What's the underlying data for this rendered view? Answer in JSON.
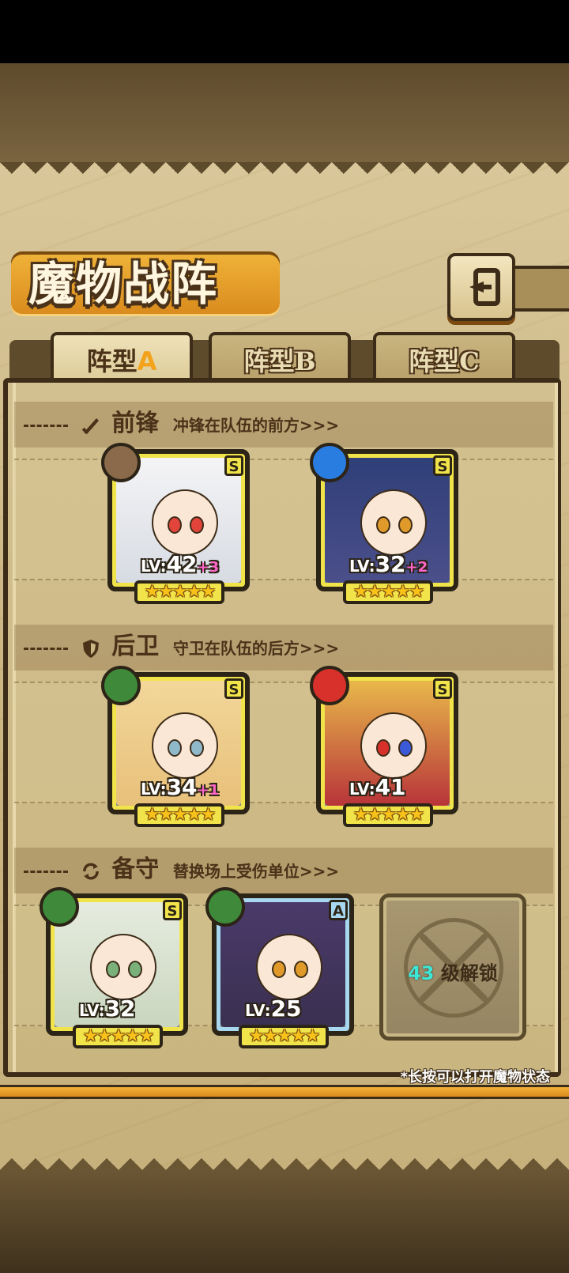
{
  "title": "魔物战阵",
  "back_button": {
    "icon": "return-arrow-icon"
  },
  "tabs": [
    {
      "prefix": "阵型",
      "suffix": "A",
      "active": true
    },
    {
      "prefix": "阵型",
      "suffix": "B",
      "active": false
    },
    {
      "prefix": "阵型",
      "suffix": "C",
      "active": false
    }
  ],
  "sections": {
    "front": {
      "name": "前锋",
      "desc": "冲锋在队伍的前方>>>",
      "icon": "sword-icon"
    },
    "rear": {
      "name": "后卫",
      "desc": "守卫在队伍的后方>>>",
      "icon": "shield-icon"
    },
    "reserve": {
      "name": "备守",
      "desc": "替换场上受伤单位>>>",
      "icon": "swap-icon"
    }
  },
  "monsters": {
    "front1": {
      "lv_prefix": "LV:",
      "lv": "42",
      "plus": "+3",
      "grade": "S",
      "element": "earth-icon",
      "stars": "★★★★★"
    },
    "front2": {
      "lv_prefix": "LV:",
      "lv": "32",
      "plus": "+2",
      "grade": "S",
      "element": "water-icon",
      "stars": "★★★★★"
    },
    "rear1": {
      "lv_prefix": "LV:",
      "lv": "34",
      "plus": "+1",
      "grade": "S",
      "element": "leaf-icon",
      "stars": "★★★★★"
    },
    "rear2": {
      "lv_prefix": "LV:",
      "lv": "41",
      "plus": "",
      "grade": "S",
      "element": "fire-icon",
      "stars": "★★★★★"
    },
    "reserve1": {
      "lv_prefix": "LV:",
      "lv": "32",
      "plus": "",
      "grade": "S",
      "element": "leaf-icon",
      "stars": "★★★★★"
    },
    "reserve2": {
      "lv_prefix": "LV:",
      "lv": "25",
      "plus": "",
      "grade": "A",
      "element": "leaf-icon",
      "stars": "★★★★★"
    }
  },
  "locked_slot": {
    "level": "43",
    "text": "级解锁"
  },
  "hint": "*长按可以打开魔物状态",
  "colors": {
    "grade_s": "#f1e44a",
    "grade_a": "#a8d8f0",
    "earth": "#8a6a4a",
    "water": "#2a7de0",
    "leaf": "#3f8a3a",
    "fire": "#d8302a",
    "plus": "#ff64c8",
    "unlock_num": "#3ee6d6"
  }
}
